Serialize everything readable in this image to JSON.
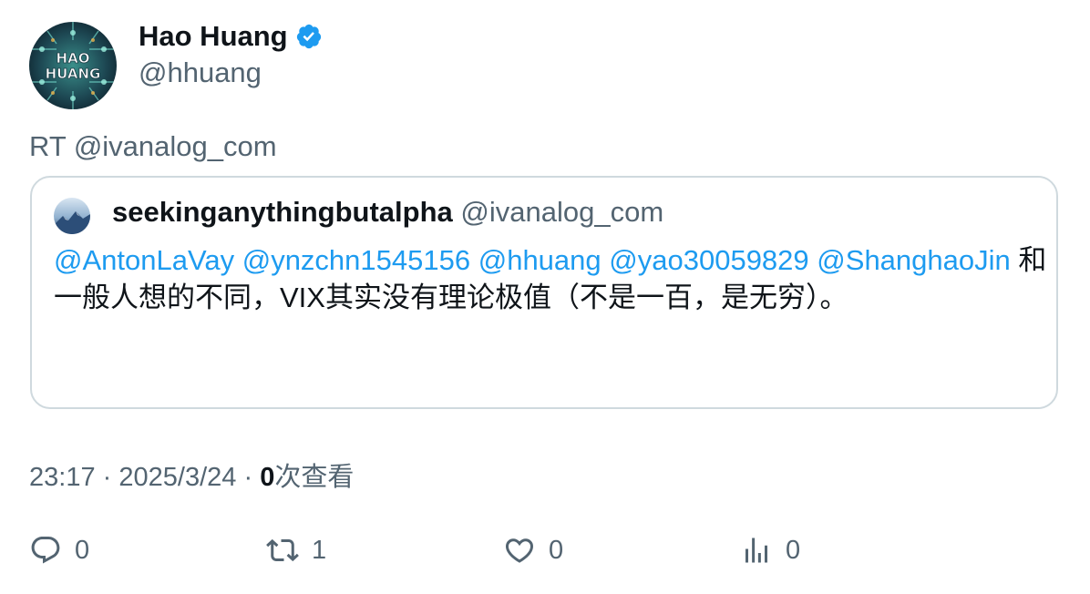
{
  "author": {
    "display_name": "Hao Huang",
    "handle": "@hhuang",
    "verified": true,
    "avatar_text_top": "HAO",
    "avatar_text_bottom": "HUANG"
  },
  "retweet_prefix": "RT @ivanalog_com",
  "quoted": {
    "display_name": "seekinganythingbutalpha",
    "handle": "@ivanalog_com",
    "mentions": [
      "@AntonLaVay",
      "@ynzchn1545156",
      "@hhuang",
      "@yao30059829",
      "@ShanghaoJin"
    ],
    "text": "和一般人想的不同，VIX其实没有理论极值（不是一百，是无穷）。"
  },
  "meta": {
    "time": "23:17",
    "sep1": "·",
    "date": "2025/3/24",
    "sep2": "·",
    "views_count": "0",
    "views_label": "次查看"
  },
  "actions": {
    "reply_count": "0",
    "retweet_count": "1",
    "like_count": "0",
    "views_count": "0"
  },
  "colors": {
    "link": "#1d9bf0",
    "muted": "#536471",
    "border": "#cfd9de",
    "verified": "#1d9bf0"
  }
}
